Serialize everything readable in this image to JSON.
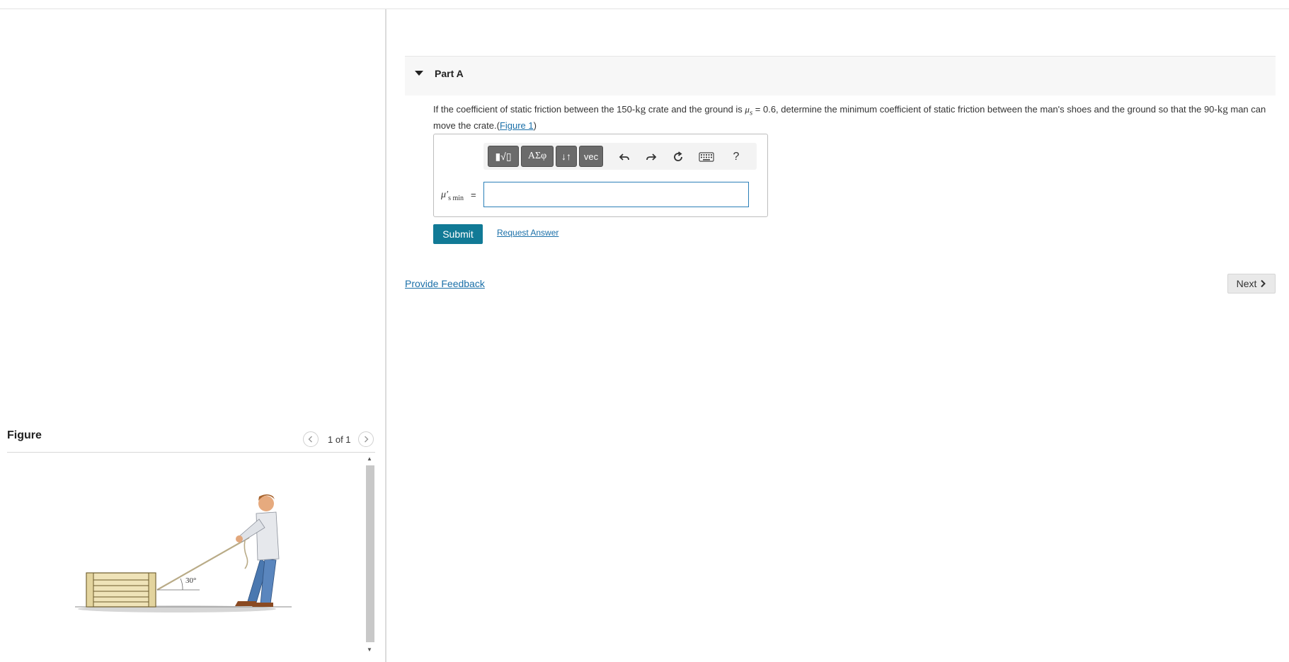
{
  "figure_panel": {
    "title": "Figure",
    "pager": "1 of 1",
    "angle_label": "30°"
  },
  "part": {
    "title": "Part A"
  },
  "question": {
    "text_1": "If the coefficient of static friction between the 150-",
    "unit_1": "kg",
    "text_2": " crate and the ground is ",
    "mu_symbol": "μ",
    "mu_sub": "s",
    "text_3": " = 0.6, determine the minimum coefficient of static friction between the man's shoes and the ground so that the 90-",
    "unit_2": "kg",
    "text_4": " man can move the crate.(",
    "figure_link": "Figure 1",
    "text_5": ")"
  },
  "toolbar": {
    "templates_label": "▮√▯",
    "greek_label": "ΑΣφ",
    "arrows_label": "↓↑",
    "vec_label": "vec",
    "help_label": "?",
    "icons": [
      "undo-icon",
      "redo-icon",
      "reset-icon",
      "keyboard-icon"
    ]
  },
  "answer": {
    "label_symbol": "μ′",
    "label_sub": "s min",
    "equals": "=",
    "value": "",
    "placeholder": ""
  },
  "actions": {
    "submit_label": "Submit",
    "request_label": "Request Answer",
    "feedback_label": "Provide Feedback",
    "next_label": "Next"
  },
  "colors": {
    "submit_bg": "#117a96",
    "link": "#1a6fa8",
    "toolbar_button": "#6b6b6b"
  }
}
